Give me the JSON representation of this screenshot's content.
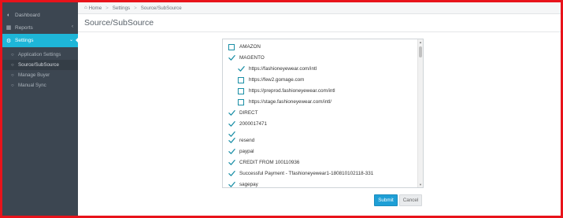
{
  "sidebar": {
    "items": [
      {
        "label": "Dashboard",
        "icon": "dashboard-icon"
      },
      {
        "label": "Reports",
        "icon": "reports-icon"
      },
      {
        "label": "Settings",
        "icon": "gears-icon"
      }
    ],
    "submenu": [
      {
        "label": "Application Settings"
      },
      {
        "label": "Source/SubSource"
      },
      {
        "label": "Manage Buyer"
      },
      {
        "label": "Manual Sync"
      }
    ]
  },
  "breadcrumb": {
    "home": "Home",
    "settings": "Settings",
    "current": "Source/SubSource"
  },
  "page_title": "Source/SubSource",
  "list": {
    "rows": [
      {
        "label": "AMAZON",
        "checked": false,
        "indent": false
      },
      {
        "label": "MAGENTO",
        "checked": true,
        "indent": false
      },
      {
        "label": "https://fashioneyewear.com/intl",
        "checked": true,
        "indent": true
      },
      {
        "label": "https://few2.gomage.com",
        "checked": false,
        "indent": true
      },
      {
        "label": "https://preprod.fashioneyewear.com/intl",
        "checked": false,
        "indent": true
      },
      {
        "label": "https://stage.fashioneyewear.com/intl/",
        "checked": false,
        "indent": true
      },
      {
        "label": "DIRECT",
        "checked": true,
        "indent": false
      },
      {
        "label": "2000017471",
        "checked": true,
        "indent": false
      },
      {
        "label": "",
        "checked": true,
        "indent": false
      },
      {
        "label": "resend",
        "checked": true,
        "indent": false
      },
      {
        "label": "paypal",
        "checked": true,
        "indent": false
      },
      {
        "label": "CREDIT FROM 100110936",
        "checked": true,
        "indent": false
      },
      {
        "label": "Successful Payment - Tfashioneyewear1-180810102118-331",
        "checked": true,
        "indent": false
      },
      {
        "label": "sagepay",
        "checked": true,
        "indent": false
      }
    ]
  },
  "buttons": {
    "submit": "Submit",
    "cancel": "Cancel"
  },
  "colors": {
    "accent": "#1eb6d8",
    "sidebar": "#3c4651",
    "check": "#1a8fa6",
    "submit": "#1e9fd6",
    "frame": "#e8131b"
  }
}
